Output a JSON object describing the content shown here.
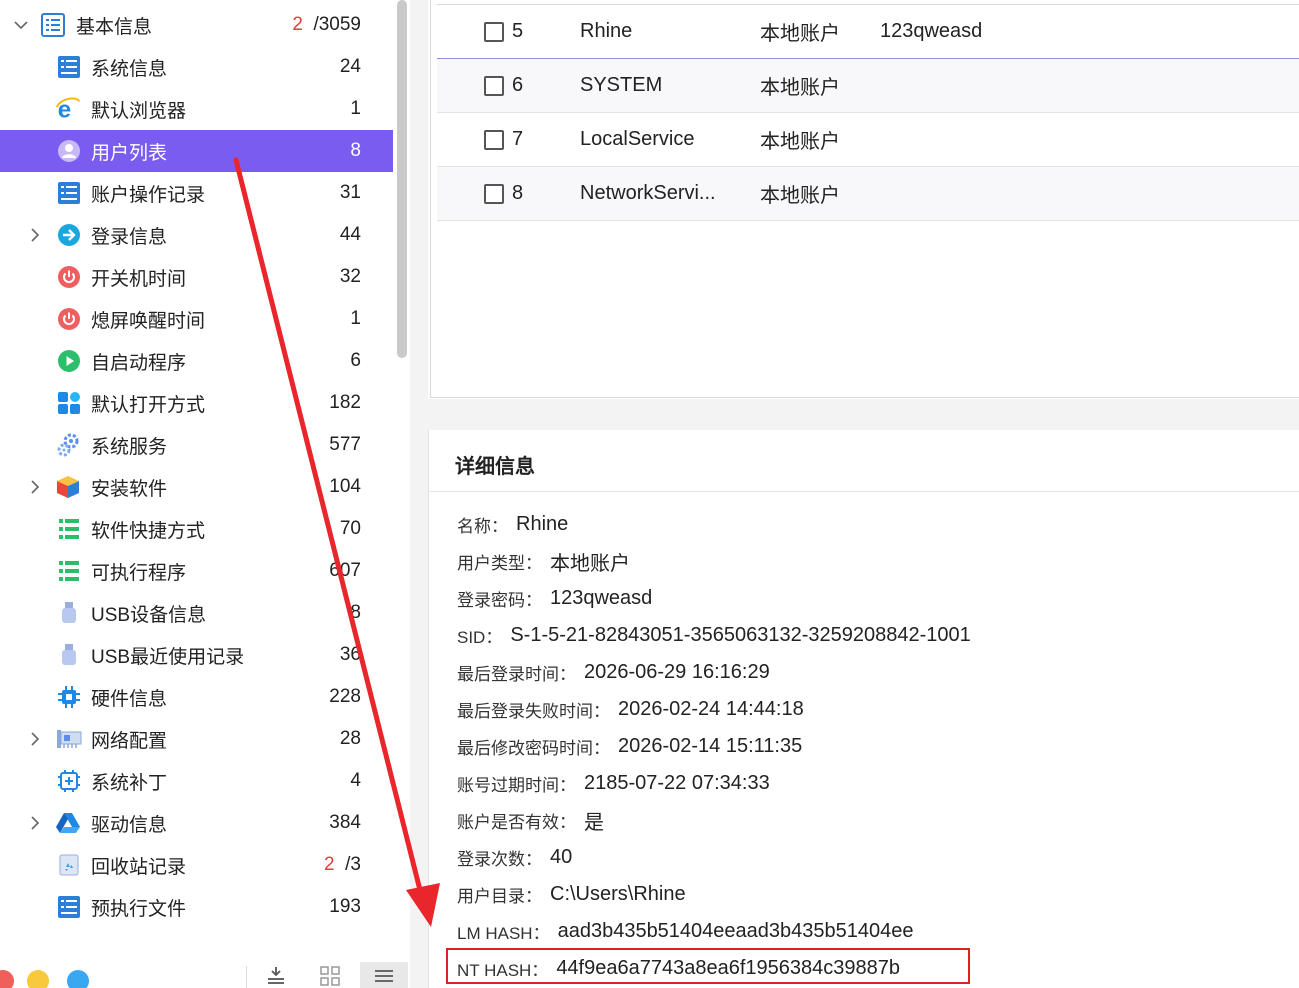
{
  "sidebar": {
    "root": {
      "label": "基本信息",
      "count_red": "2",
      "count_total": "/3059"
    },
    "items": [
      {
        "label": "系统信息",
        "count": "24"
      },
      {
        "label": "默认浏览器",
        "count": "1"
      },
      {
        "label": "用户列表",
        "count": "8"
      },
      {
        "label": "账户操作记录",
        "count": "31"
      },
      {
        "label": "登录信息",
        "count": "44"
      },
      {
        "label": "开关机时间",
        "count": "32"
      },
      {
        "label": "熄屏唤醒时间",
        "count": "1"
      },
      {
        "label": "自启动程序",
        "count": "6"
      },
      {
        "label": "默认打开方式",
        "count": "182"
      },
      {
        "label": "系统服务",
        "count": "577"
      },
      {
        "label": "安装软件",
        "count": "104"
      },
      {
        "label": "软件快捷方式",
        "count": "70"
      },
      {
        "label": "可执行程序",
        "count": "607"
      },
      {
        "label": "USB设备信息",
        "count": "8"
      },
      {
        "label": "USB最近使用记录",
        "count": "36"
      },
      {
        "label": "硬件信息",
        "count": "228"
      },
      {
        "label": "网络配置",
        "count": "28"
      },
      {
        "label": "系统补丁",
        "count": "4"
      },
      {
        "label": "驱动信息",
        "count": "384"
      },
      {
        "label": "回收站记录",
        "count_red": "2",
        "count_total": "/3"
      },
      {
        "label": "预执行文件",
        "count": "193"
      }
    ]
  },
  "table": {
    "rows": [
      {
        "index": "5",
        "name": "Rhine",
        "type": "本地账户",
        "password": "123qweasd"
      },
      {
        "index": "6",
        "name": "SYSTEM",
        "type": "本地账户",
        "password": ""
      },
      {
        "index": "7",
        "name": "LocalService",
        "type": "本地账户",
        "password": ""
      },
      {
        "index": "8",
        "name": "NetworkServi...",
        "type": "本地账户",
        "password": ""
      }
    ]
  },
  "detail": {
    "title": "详细信息",
    "fields": [
      {
        "key": "名称：",
        "value": "Rhine"
      },
      {
        "key": "用户类型：",
        "value": "本地账户"
      },
      {
        "key": "登录密码：",
        "value": "123qweasd"
      },
      {
        "key": "SID：",
        "value": "S-1-5-21-82843051-3565063132-3259208842-1001"
      },
      {
        "key": "最后登录时间：",
        "value": "2026-06-29 16:16:29"
      },
      {
        "key": "最后登录失败时间：",
        "value": "2026-02-24 14:44:18"
      },
      {
        "key": "最后修改密码时间：",
        "value": "2026-02-14 15:11:35"
      },
      {
        "key": "账号过期时间：",
        "value": "2185-07-22 07:34:33"
      },
      {
        "key": "账户是否有效：",
        "value": "是"
      },
      {
        "key": "登录次数：",
        "value": "40"
      },
      {
        "key": "用户目录：",
        "value": "C:\\Users\\Rhine"
      },
      {
        "key": "LM HASH：",
        "value": "aad3b435b51404eeaad3b435b51404ee"
      },
      {
        "key": "NT HASH：",
        "value": "44f9ea6a7743a8ea6f1956384c39887b"
      }
    ]
  },
  "colors": {
    "selected": "#7B5CF0",
    "highlight_box": "#E02020",
    "arrow": "#E8262B",
    "count_red": "#E43B3B"
  }
}
